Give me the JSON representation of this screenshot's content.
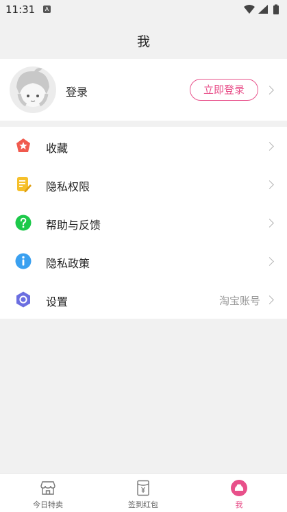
{
  "status_bar": {
    "time": "11:31",
    "indicator": "A"
  },
  "header": {
    "title": "我"
  },
  "profile": {
    "login_text": "登录",
    "login_button": "立即登录"
  },
  "menu": [
    {
      "label": "收藏",
      "icon": "star-icon",
      "extra": ""
    },
    {
      "label": "隐私权限",
      "icon": "document-edit-icon",
      "extra": ""
    },
    {
      "label": "帮助与反馈",
      "icon": "help-icon",
      "extra": ""
    },
    {
      "label": "隐私政策",
      "icon": "info-icon",
      "extra": ""
    },
    {
      "label": "设置",
      "icon": "settings-icon",
      "extra": "淘宝账号"
    }
  ],
  "tabbar": [
    {
      "label": "今日特卖",
      "icon": "shop-icon",
      "active": false
    },
    {
      "label": "签到红包",
      "icon": "red-envelope-icon",
      "active": false
    },
    {
      "label": "我",
      "icon": "profile-icon",
      "active": true
    }
  ],
  "colors": {
    "accent": "#e8508a",
    "background": "#f1f1f1"
  }
}
